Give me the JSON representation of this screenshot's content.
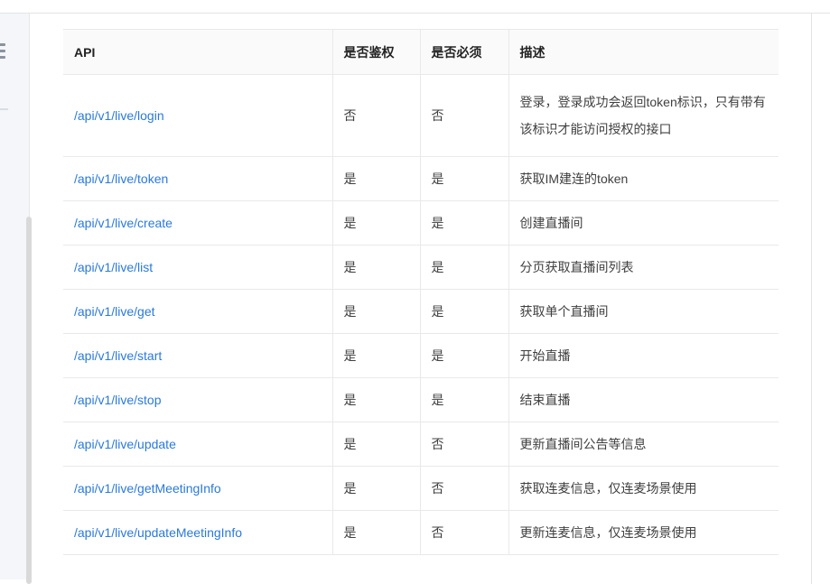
{
  "colors": {
    "link": "#2a79dc",
    "border": "#e9e9e9",
    "header-bg": "#fafafa",
    "sidebar-bg": "#f4f6f9",
    "scroll-thumb": "#d9d9d9"
  },
  "sidebar": {
    "menu_icon": "hamburger-menu-icon"
  },
  "table": {
    "headers": [
      "API",
      "是否鉴权",
      "是否必须",
      "描述"
    ],
    "rows": [
      {
        "api": "/api/v1/live/login",
        "auth": "否",
        "required": "否",
        "desc": "登录，登录成功会返回token标识，只有带有该标识才能访问授权的接口"
      },
      {
        "api": "/api/v1/live/token",
        "auth": "是",
        "required": "是",
        "desc": "获取IM建连的token"
      },
      {
        "api": "/api/v1/live/create",
        "auth": "是",
        "required": "是",
        "desc": "创建直播间"
      },
      {
        "api": "/api/v1/live/list",
        "auth": "是",
        "required": "是",
        "desc": "分页获取直播间列表"
      },
      {
        "api": "/api/v1/live/get",
        "auth": "是",
        "required": "是",
        "desc": "获取单个直播间"
      },
      {
        "api": "/api/v1/live/start",
        "auth": "是",
        "required": "是",
        "desc": "开始直播"
      },
      {
        "api": "/api/v1/live/stop",
        "auth": "是",
        "required": "是",
        "desc": "结束直播"
      },
      {
        "api": "/api/v1/live/update",
        "auth": "是",
        "required": "否",
        "desc": "更新直播间公告等信息"
      },
      {
        "api": "/api/v1/live/getMeetingInfo",
        "auth": "是",
        "required": "否",
        "desc": "获取连麦信息，仅连麦场景使用"
      },
      {
        "api": "/api/v1/live/updateMeetingInfo",
        "auth": "是",
        "required": "否",
        "desc": "更新连麦信息，仅连麦场景使用"
      }
    ]
  }
}
